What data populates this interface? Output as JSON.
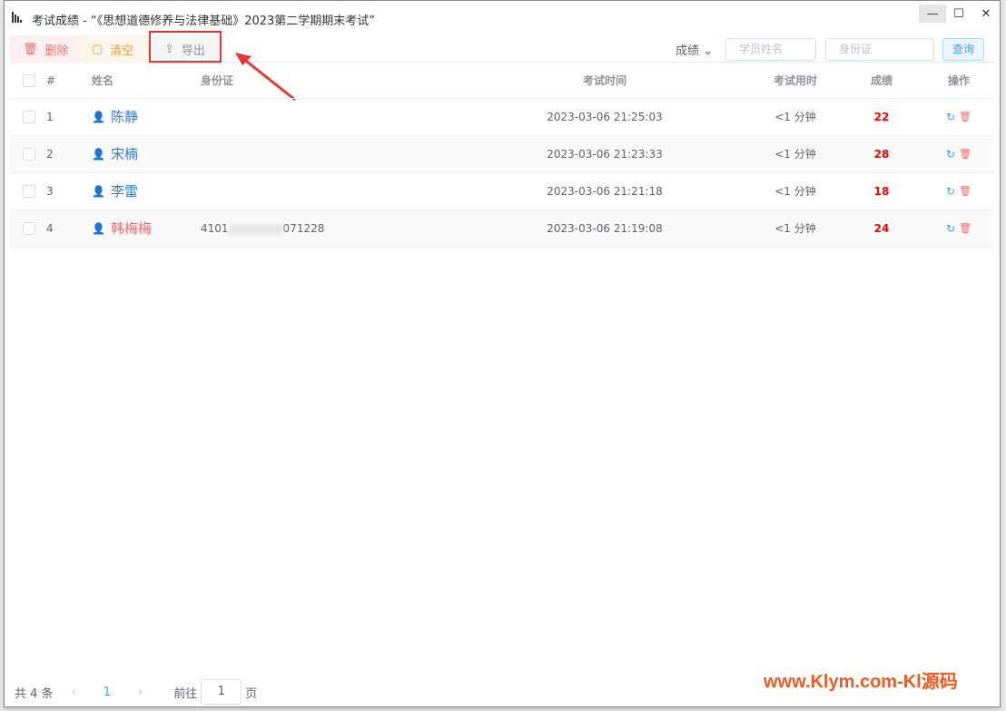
{
  "window": {
    "title": "考试成绩 - “《思想道德修养与法律基础》2023第二学期期末考试”",
    "minimize": "—",
    "maximize": "☐",
    "close": "✕"
  },
  "toolbar": {
    "delete": "删除",
    "clear": "清空",
    "export": "导出",
    "sort": "成绩",
    "name_placeholder": "学员姓名",
    "id_placeholder": "身份证",
    "query": "查询"
  },
  "table": {
    "headers": [
      "#",
      "姓名",
      "身份证",
      "考试时间",
      "考试用时",
      "成绩",
      "操作"
    ],
    "rows": [
      {
        "no": "1",
        "name": "陈静",
        "gender": "male",
        "id_a": "",
        "id_b": "",
        "time": "2023-03-06 21:25:03",
        "duration": "<1 分钟",
        "score": "22"
      },
      {
        "no": "2",
        "name": "宋楠",
        "gender": "male",
        "id_a": "",
        "id_b": "",
        "time": "2023-03-06 21:23:33",
        "duration": "<1 分钟",
        "score": "28"
      },
      {
        "no": "3",
        "name": "李雷",
        "gender": "male",
        "id_a": "",
        "id_b": "",
        "time": "2023-03-06 21:21:18",
        "duration": "<1 分钟",
        "score": "18"
      },
      {
        "no": "4",
        "name": "韩梅梅",
        "gender": "female",
        "id_a": "4101",
        "id_b": "071228",
        "time": "2023-03-06 21:19:08",
        "duration": "<1 分钟",
        "score": "24"
      }
    ]
  },
  "pager": {
    "total": "共 4 条",
    "page": "1",
    "goto": "前往",
    "goto_value": "1",
    "page_unit": "页"
  },
  "watermark": "www.Klym.com-Kl源码"
}
